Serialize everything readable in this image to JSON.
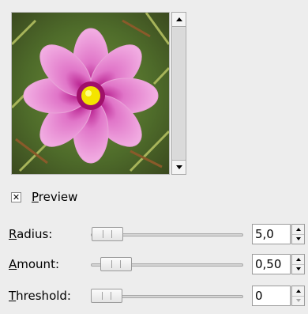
{
  "preview": {
    "checkbox_checked": true,
    "label_mnemonic": "P",
    "label_rest": "review",
    "image_subject": "pink-flower"
  },
  "controls": [
    {
      "mnemonic": "R",
      "rest": "adius:",
      "value": "5,0",
      "slider_fraction": 0.05
    },
    {
      "mnemonic": "A",
      "rest": "mount:",
      "value": "0,50",
      "slider_fraction": 0.1
    },
    {
      "mnemonic": "T",
      "rest": "hreshold:",
      "value": "0",
      "slider_fraction": 0.0
    }
  ],
  "icons": {
    "scroll_up": "arrow-up-icon",
    "scroll_down": "arrow-down-icon",
    "spin_up": "spin-up-icon",
    "spin_down": "spin-down-icon"
  }
}
